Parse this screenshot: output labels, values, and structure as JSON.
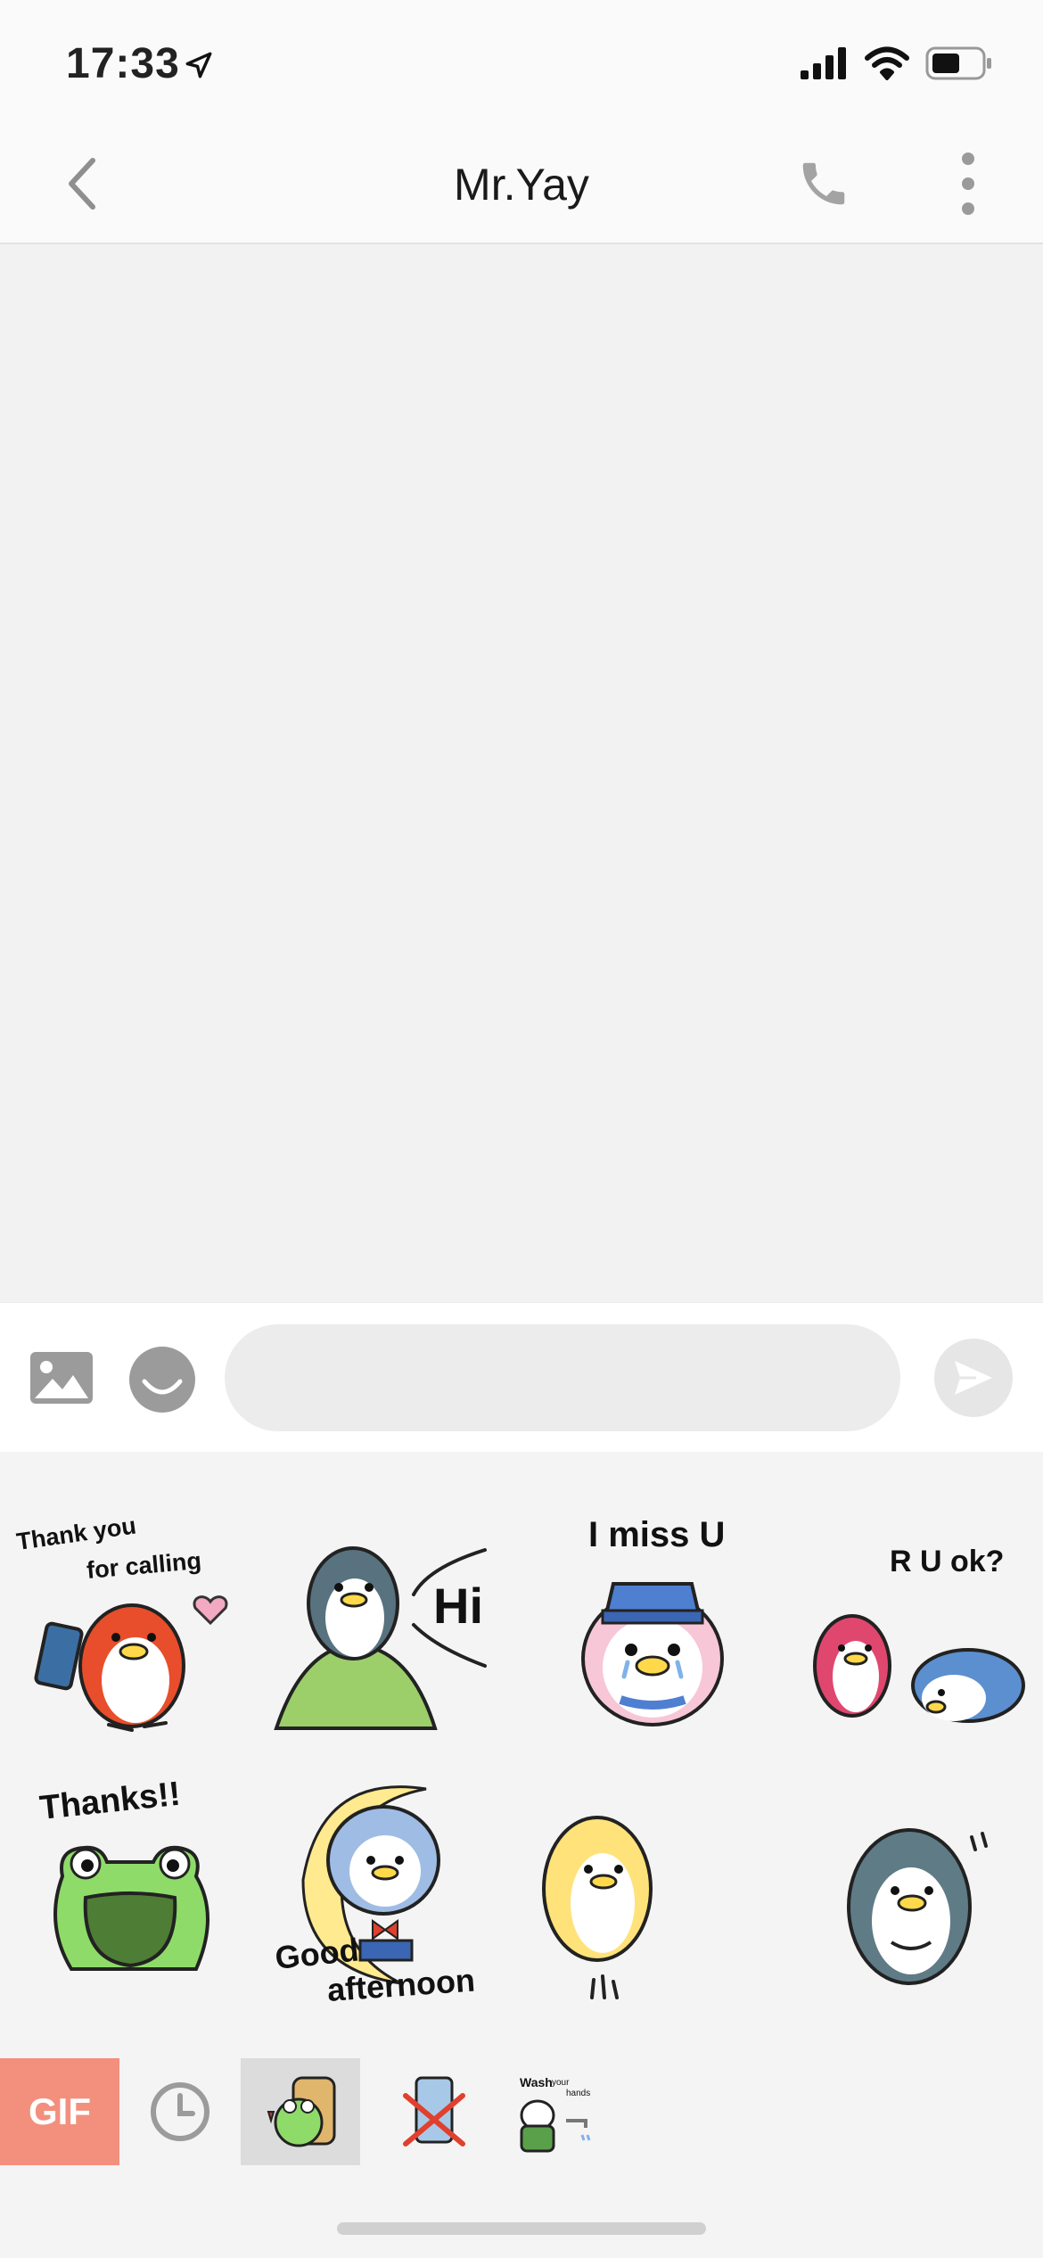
{
  "status_bar": {
    "time": "17:33"
  },
  "header": {
    "title": "Mr.Yay"
  },
  "composer": {
    "placeholder": ""
  },
  "stickers": [
    {
      "name": "thank-you-for-calling",
      "line1": "Thank you",
      "line2": "for calling"
    },
    {
      "name": "hi",
      "text": "Hi"
    },
    {
      "name": "i-miss-u",
      "text": "I miss U"
    },
    {
      "name": "r-u-ok",
      "text": "R U ok?"
    },
    {
      "name": "thanks",
      "text": "Thanks!!"
    },
    {
      "name": "good-afternoon",
      "line1": "Good",
      "line2": "afternoon"
    },
    {
      "name": "yellow-penguin-jump"
    },
    {
      "name": "gray-penguin-shy"
    }
  ],
  "tabs": {
    "gif_label": "GIF",
    "wash_line1": "Wash",
    "wash_line2": "your",
    "wash_line3": "hands"
  },
  "colors": {
    "gif_tab": "#f2907d",
    "nav_icons": "#9a9a9a"
  }
}
